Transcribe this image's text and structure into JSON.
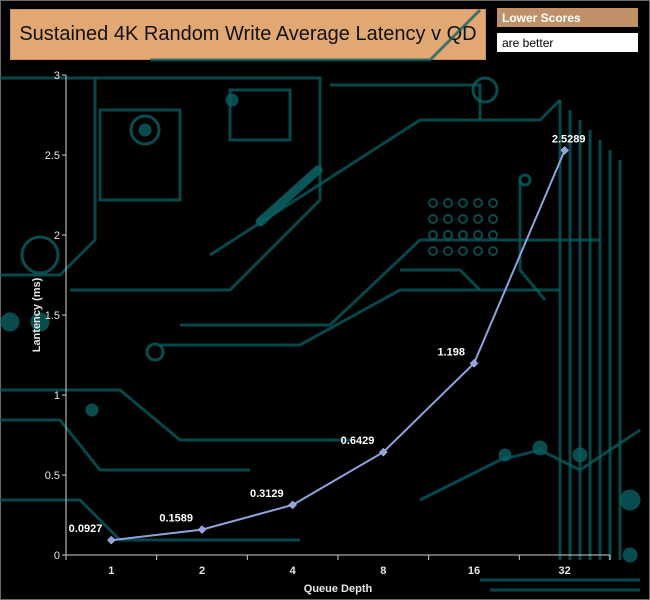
{
  "title": "Sustained 4K Random Write Average Latency v QD",
  "legend": {
    "label": "Lower Scores",
    "note": "are better"
  },
  "colors": {
    "title_bg": "#e2a873",
    "legend_bg": "#c09168",
    "series": "#8fa3dd",
    "decor": "#0a5f62"
  },
  "chart_data": {
    "type": "line",
    "title": "Sustained 4K Random Write Average Latency v QD",
    "xlabel": "Queue Depth",
    "ylabel": "Lantency (ms)",
    "categories": [
      "1",
      "2",
      "4",
      "8",
      "16",
      "32"
    ],
    "yticks": [
      "0",
      "0.5",
      "1",
      "1.5",
      "2",
      "2.5",
      "3"
    ],
    "ylim": [
      0,
      3
    ],
    "grid": false,
    "series": [
      {
        "values": [
          0.0927,
          0.1589,
          0.3129,
          0.6429,
          1.198,
          2.5289
        ],
        "labels": [
          "0.0927",
          "0.1589",
          "0.3129",
          "0.6429",
          "1.198",
          "2.5289"
        ]
      }
    ]
  }
}
